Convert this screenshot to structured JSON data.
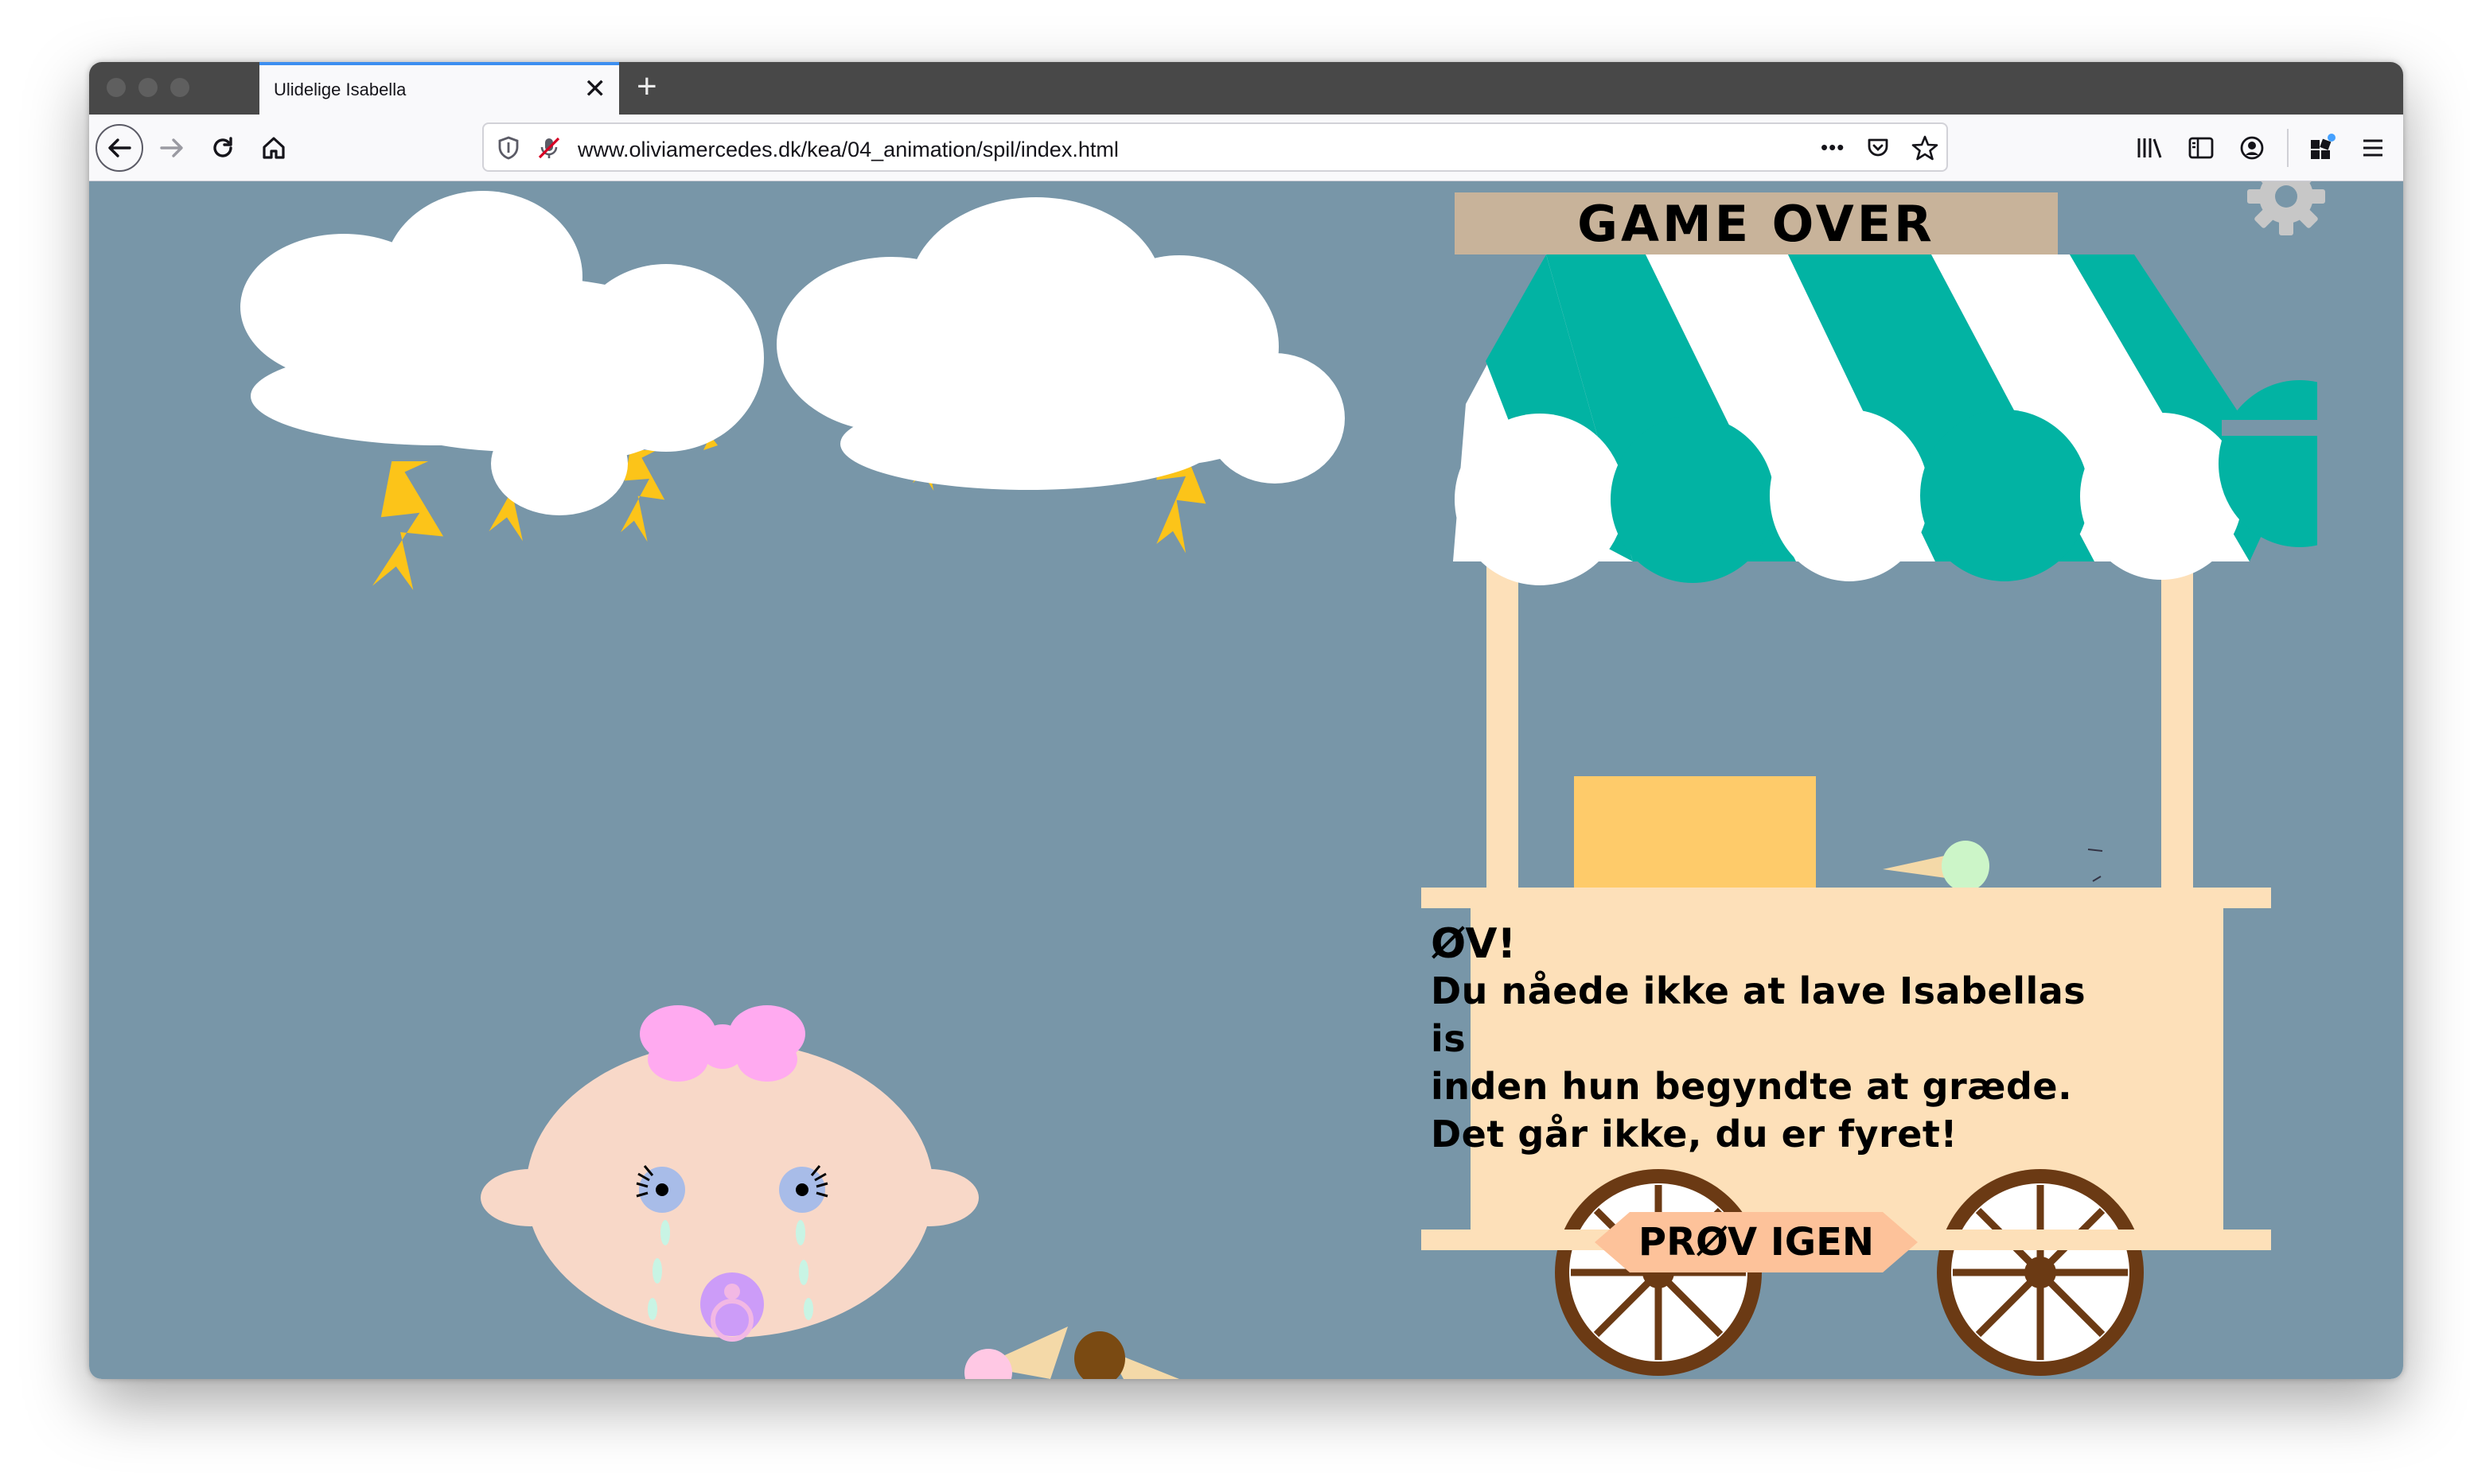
{
  "browser": {
    "tab_title": "Ulidelige Isabella",
    "tab_close": "✕",
    "new_tab": "+",
    "url": "www.oliviamercedes.dk/kea/04_animation/spil/index.html",
    "url_more": "•••"
  },
  "game": {
    "board_title": "GAME OVER",
    "message_title": "ØV!",
    "message_lines": [
      "Du nåede ikke at lave Isabellas is",
      "inden hun begyndte at græde.",
      "Det går ikke, du er fyret!"
    ],
    "retry_label": "PRØV IGEN"
  },
  "colors": {
    "background": "#7896a8",
    "cloud": "#ffffff",
    "lightning": "#fcc419",
    "awning_green": "#02b3a3",
    "cart": "#fde0b9",
    "board": "#c8b39a",
    "wheel": "#6b3a14",
    "box": "#fecb6a",
    "button": "#fdc29a",
    "baby_skin": "#f8d8c8",
    "bow": "#ffaaf0",
    "pacifier": "#cc9cf8"
  },
  "icons": [
    "back-arrow-icon",
    "forward-arrow-icon",
    "reload-icon",
    "home-icon",
    "shield-icon",
    "mic-blocked-icon",
    "more-icon",
    "pocket-icon",
    "star-icon",
    "library-icon",
    "sidebar-icon",
    "account-icon",
    "extensions-icon",
    "menu-icon",
    "settings-gear-icon"
  ]
}
